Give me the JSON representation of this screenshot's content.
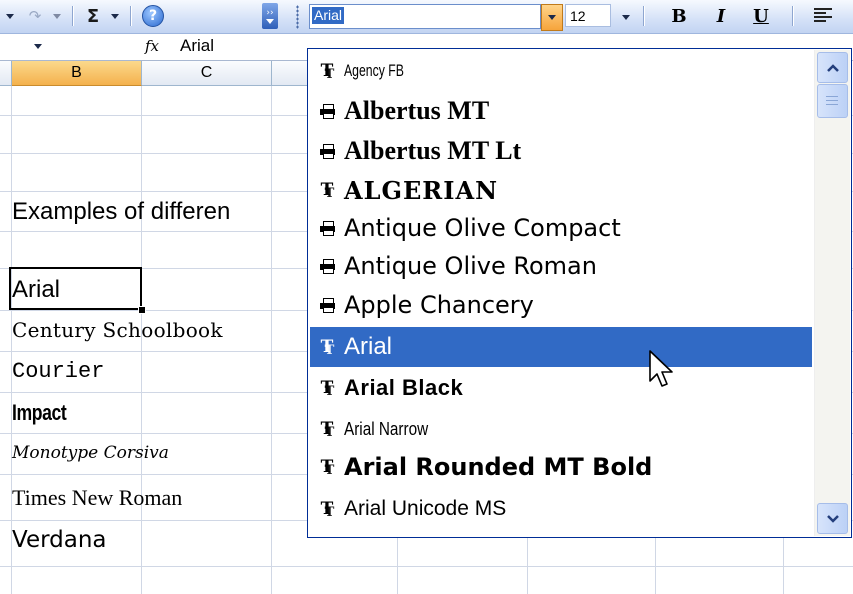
{
  "toolbar": {
    "redo_icon": "redo-icon",
    "autosum_symbol": "Σ",
    "help_symbol": "?",
    "font_name_value": "Arial",
    "font_size_value": "12",
    "bold_label": "B",
    "italic_label": "I",
    "underline_label": "U"
  },
  "formula_bar": {
    "fx_label": "fx",
    "value": "Arial"
  },
  "columns": [
    "B",
    "C"
  ],
  "cells": [
    {
      "text": "Examples of differen",
      "font": "Liberation Sans"
    },
    {
      "text": "Arial",
      "font": "Liberation Sans"
    },
    {
      "text": "Century Schoolbook",
      "font": "DejaVu Serif"
    },
    {
      "text": "Courier",
      "font": "Liberation Mono"
    },
    {
      "text": "Impact",
      "font": "Liberation Sans"
    },
    {
      "text": "Monotype Corsiva",
      "font": "DejaVu Serif"
    },
    {
      "text": "Times New Roman",
      "font": "Liberation Serif"
    },
    {
      "text": "Verdana",
      "font": "DejaVu Sans"
    }
  ],
  "font_list": {
    "selected_index": 7,
    "items": [
      {
        "name": "Agency FB",
        "icon": "truetype-icon"
      },
      {
        "name": "Albertus MT",
        "icon": "printer-font-icon"
      },
      {
        "name": "Albertus MT Lt",
        "icon": "printer-font-icon"
      },
      {
        "name": "ALGERIAN",
        "icon": "truetype-icon"
      },
      {
        "name": "Antique Olive Compact",
        "icon": "printer-font-icon"
      },
      {
        "name": "Antique Olive Roman",
        "icon": "printer-font-icon"
      },
      {
        "name": "Apple Chancery",
        "icon": "printer-font-icon"
      },
      {
        "name": "Arial",
        "icon": "truetype-icon"
      },
      {
        "name": "Arial Black",
        "icon": "truetype-icon"
      },
      {
        "name": "Arial Narrow",
        "icon": "truetype-icon"
      },
      {
        "name": "Arial Rounded MT Bold",
        "icon": "truetype-icon"
      },
      {
        "name": "Arial Unicode MS",
        "icon": "truetype-icon"
      }
    ]
  },
  "colors": {
    "selection": "#316ac5",
    "active_header": "#f4b14d",
    "grid_line": "#d0d7e5"
  }
}
